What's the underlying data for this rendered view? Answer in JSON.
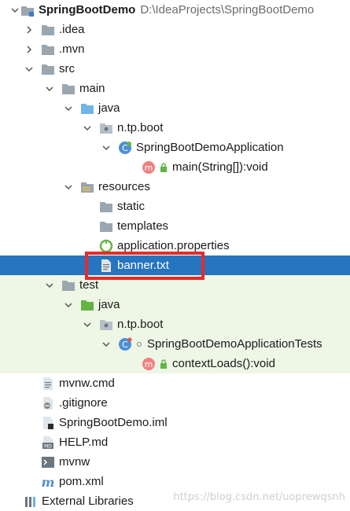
{
  "project_tree": {
    "root": {
      "label": "SpringBootDemo",
      "path": "D:\\IdeaProjects\\SpringBootDemo"
    },
    "idea": ".idea",
    "mvn": ".mvn",
    "src": "src",
    "main": "main",
    "main_java": "java",
    "main_pkg": "n.tp.boot",
    "app_class": "SpringBootDemoApplication",
    "app_method": "main(String[]):void",
    "resources": "resources",
    "static": "static",
    "templates": "templates",
    "app_props": "application.properties",
    "banner": "banner.txt",
    "test": "test",
    "test_java": "java",
    "test_pkg": "n.tp.boot",
    "test_class": "SpringBootDemoApplicationTests",
    "test_method": "contextLoads():void",
    "mvnw_cmd": "mvnw.cmd",
    "gitignore": ".gitignore",
    "iml": "SpringBootDemo.iml",
    "help": "HELP.md",
    "mvnw": "mvnw",
    "pom": "pom.xml",
    "external_libs": "External Libraries"
  },
  "icons": {
    "folder": "folder-icon",
    "source_folder": "java-source-folder-icon",
    "package": "package-icon",
    "class": "class-icon",
    "method": "method-icon",
    "lock": "lock-icon",
    "file": "file-icon"
  },
  "colors": {
    "selection": "#2675bf",
    "test_background": "#eef6e6",
    "highlight_border": "#e82a2a",
    "folder": "#9aa7b0",
    "source_folder": "#6fb5e8",
    "test_folder": "#62b543"
  },
  "watermark": "https://blog.csdn.net/uoprewqsnh"
}
